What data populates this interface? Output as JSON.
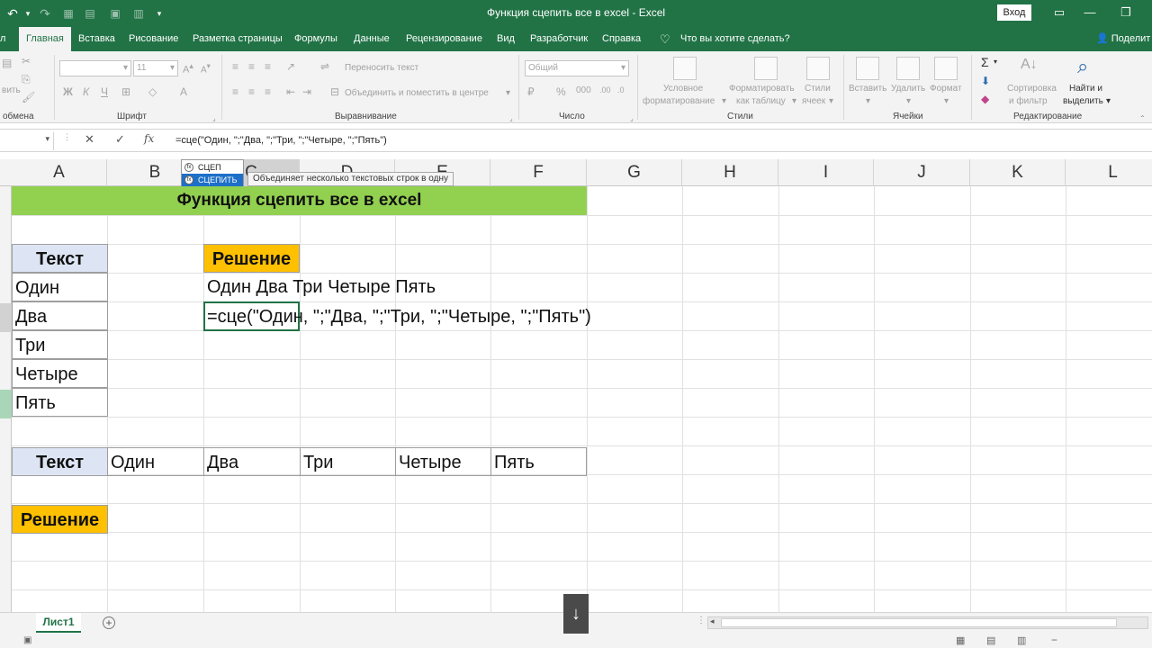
{
  "window": {
    "title": "Функция сцепить все в excel  -  Excel",
    "login_label": "Вход"
  },
  "tabs": [
    "Главная",
    "Вставка",
    "Рисование",
    "Разметка страницы",
    "Формулы",
    "Данные",
    "Рецензирование",
    "Вид",
    "Разработчик",
    "Справка"
  ],
  "tell_me": "Что вы хотите сделать?",
  "share_label": "Поделит",
  "ribbon": {
    "clipboard_partial": "вить",
    "clipboard_label": "обмена",
    "font_size": "11",
    "font_label": "Шрифт",
    "wrap_text": "Переносить текст",
    "merge_center": "Объединить и поместить в центре",
    "alignment_label": "Выравнивание",
    "number_format": "Общий",
    "number_label": "Число",
    "conditional_formatting_1": "Условное",
    "conditional_formatting_2": "форматирование",
    "format_as_table_1": "Форматировать",
    "format_as_table_2": "как таблицу",
    "cell_styles_1": "Стили",
    "cell_styles_2": "ячеек",
    "styles_label": "Стили",
    "insert": "Вставить",
    "delete": "Удалить",
    "format": "Формат",
    "cells_label": "Ячейки",
    "sort_filter_1": "Сортировка",
    "sort_filter_2": "и фильтр",
    "find_select_1": "Найти и",
    "find_select_2": "выделить",
    "editing_label": "Редактирование"
  },
  "formula_bar": {
    "fx": "fx",
    "formula": "=сце(\"Один, \";\"Два, \";\"Три, \";\"Четыре, \";\"Пять\")"
  },
  "columns": [
    "A",
    "B",
    "C",
    "D",
    "E",
    "F",
    "G",
    "H",
    "I",
    "J",
    "K",
    "L"
  ],
  "autocomplete": {
    "items": [
      "СЦЕП",
      "СЦЕПИТЬ"
    ],
    "tooltip": "Объединяет несколько текстовых строк в одну"
  },
  "sheet": {
    "banner": "Функция сцепить все в excel",
    "text_header": "Текст",
    "list": [
      "Один",
      "Два",
      "Три",
      "Четыре",
      "Пять"
    ],
    "solution_label": "Решение",
    "result": "Один Два Три Четыре Пять",
    "editing_formula": "=сце(\"Один, \";\"Два, \";\"Три, \";\"Четыре, \";\"Пять\")",
    "row_text_header": "Текст",
    "row_items": [
      "Один",
      "Два",
      "Три",
      "Четыре",
      "Пять"
    ],
    "solution_label_2": "Решение"
  },
  "sheet_tab": "Лист1",
  "colors": {
    "excel_green": "#217346",
    "banner_green": "#92d050",
    "header_blue": "#dde5f4",
    "solution_yellow": "#ffc000"
  }
}
